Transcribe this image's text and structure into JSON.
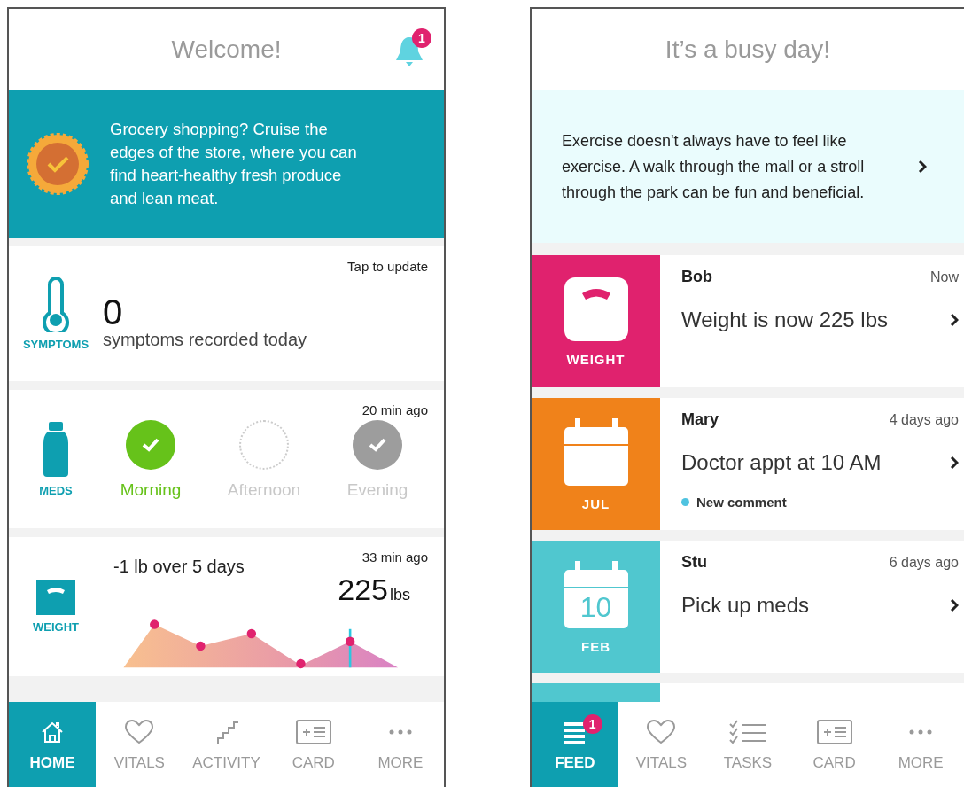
{
  "home": {
    "title": "Welcome!",
    "notification_badge": "1",
    "tip": {
      "text": "Grocery shopping? Cruise the edges of the store, where you can find heart-healthy fresh produce and lean meat."
    },
    "symptoms": {
      "label": "SYMPTOMS",
      "action": "Tap to update",
      "count": "0",
      "caption": "symptoms recorded today"
    },
    "meds": {
      "label": "MEDS",
      "time": "20 min ago",
      "doses": [
        {
          "label": "Morning",
          "checked": true,
          "color": "#66c21a"
        },
        {
          "label": "Afternoon",
          "checked": false,
          "color": "#cccccc"
        },
        {
          "label": "Evening",
          "checked": true,
          "color": "#9d9d9d"
        }
      ]
    },
    "weight": {
      "label": "WEIGHT",
      "trend": "-1 lb over 5 days",
      "time": "33 min ago",
      "value": "225",
      "unit": "lbs"
    },
    "tabs": [
      {
        "kind": "home",
        "label": "HOME",
        "selected": true
      },
      {
        "kind": "vitals",
        "label": "VITALS",
        "selected": false
      },
      {
        "kind": "activity",
        "label": "ACTIVITY",
        "selected": false
      },
      {
        "kind": "card",
        "label": "CARD",
        "selected": false
      },
      {
        "kind": "more",
        "label": "MORE",
        "selected": false
      }
    ]
  },
  "feed": {
    "title": "It’s a busy day!",
    "tip": {
      "text": "Exercise doesn't always have to feel like exercise. A walk through the mall or a stroll through the park can be fun and beneficial."
    },
    "items": [
      {
        "kind": "weight",
        "color": "#e0226e",
        "tile_label": "WEIGHT",
        "name": "Bob",
        "time": "Now",
        "message": "Weight is now 225 lbs"
      },
      {
        "kind": "calendar",
        "color": "#f0821a",
        "tile_label": "JUL",
        "name": "Mary",
        "time": "4 days ago",
        "message": "Doctor appt at 10 AM",
        "comment": "New comment"
      },
      {
        "kind": "calendar",
        "color": "#50c7cf",
        "day": "10",
        "tile_label": "FEB",
        "name": "Stu",
        "time": "6 days ago",
        "message": "Pick up meds"
      },
      {
        "kind": "partial",
        "color": "#50c7cf"
      }
    ],
    "tabs": [
      {
        "kind": "feed",
        "label": "FEED",
        "selected": true,
        "badge": "1"
      },
      {
        "kind": "vitals",
        "label": "VITALS",
        "selected": false
      },
      {
        "kind": "tasks",
        "label": "TASKS",
        "selected": false
      },
      {
        "kind": "card",
        "label": "CARD",
        "selected": false
      },
      {
        "kind": "more",
        "label": "MORE",
        "selected": false
      }
    ]
  }
}
